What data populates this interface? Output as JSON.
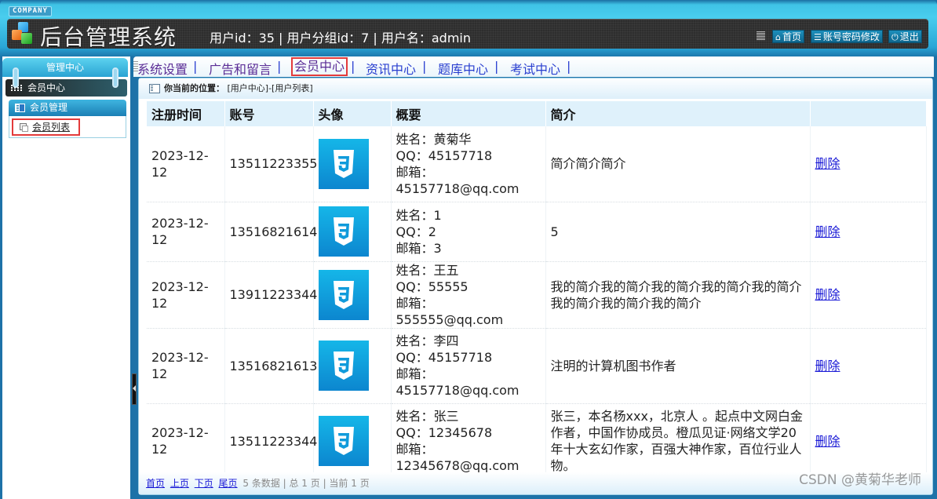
{
  "header": {
    "company": "COMPANY",
    "title": "后台管理系统",
    "user_info": "用户id：35 | 用户分组id：7 | 用户名：admin",
    "buttons": {
      "home": "首页",
      "change_password": "账号密码修改",
      "logout": "退出"
    }
  },
  "sidebar": {
    "header": "管理中心",
    "section": "会员中心",
    "group": "会员管理",
    "items": [
      {
        "label": "会员列表",
        "active": true
      }
    ]
  },
  "topnav": {
    "items": [
      {
        "label": "系统设置",
        "active": false
      },
      {
        "label": "广告和留言",
        "active": false
      },
      {
        "label": "会员中心",
        "active": true
      },
      {
        "label": "资讯中心",
        "active": false
      },
      {
        "label": "题库中心",
        "active": false
      },
      {
        "label": "考试中心",
        "active": false
      }
    ],
    "separator": "|"
  },
  "breadcrumb": {
    "label": "你当前的位置：",
    "path": "[用户中心]-[用户列表]"
  },
  "table": {
    "columns": [
      "注册时间",
      "账号",
      "头像",
      "概要",
      "简介",
      ""
    ],
    "summary_labels": {
      "name": "姓名：",
      "qq": "QQ：",
      "email": "邮箱："
    },
    "action_label": "删除",
    "rows": [
      {
        "date": "2023-12-12",
        "account": "13511223355",
        "name": "黄菊华",
        "qq": "45157718",
        "email": "45157718@qq.com",
        "intro": "简介简介简介"
      },
      {
        "date": "2023-12-12",
        "account": "13516821614",
        "name": "1",
        "qq": "2",
        "email": "3",
        "intro": "5"
      },
      {
        "date": "2023-12-12",
        "account": "13911223344",
        "name": "王五",
        "qq": "55555",
        "email": "555555@qq.com",
        "intro": "我的简介我的简介我的简介我的简介我的简介我的简介我的简介我的简介"
      },
      {
        "date": "2023-12-12",
        "account": "13516821613",
        "name": "李四",
        "qq": "45157718",
        "email": "45157718@qq.com",
        "intro": "注明的计算机图书作者"
      },
      {
        "date": "2023-12-12",
        "account": "13511223344",
        "name": "张三",
        "qq": "12345678",
        "email": "12345678@qq.com",
        "intro": "张三，本名杨xxx，北京人 。起点中文网白金作者，中国作协成员。橙瓜见证·网络文学20年十大玄幻作家，百强大神作家，百位行业人物。"
      }
    ]
  },
  "pager": {
    "first": "首页",
    "prev": "上页",
    "next": "下页",
    "last": "尾页",
    "status": "5 条数据 | 总 1 页 | 当前 1 页"
  },
  "watermark": "CSDN @黄菊华老师",
  "colors": {
    "header_blue": "#49cdee",
    "title_bar": "#2e2e2e",
    "nav_text": "#5b2d96",
    "highlight_border": "#e33b3b",
    "link_blue": "#1a1ad6",
    "table_header_bg": "#dff1fb",
    "avatar_blue": "#0c86cf"
  }
}
